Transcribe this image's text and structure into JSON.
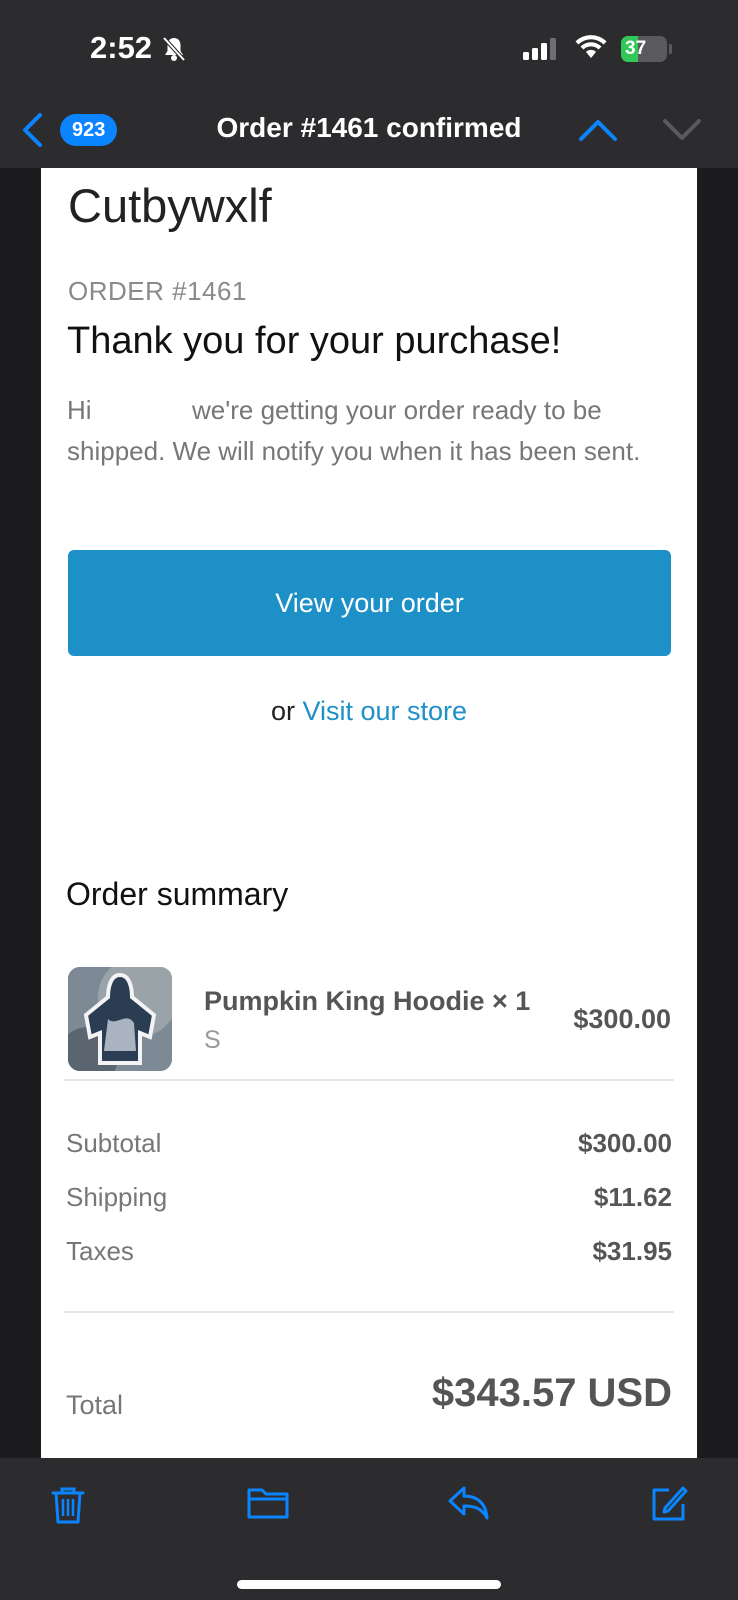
{
  "status_bar": {
    "time": "2:52",
    "battery": "37",
    "battery_level": 0.37
  },
  "nav": {
    "unread_count": "923",
    "title": "Order #1461 confirmed"
  },
  "email": {
    "store_name": "Cutbywxlf",
    "order_number": "ORDER #1461",
    "heading": "Thank you for your purchase!",
    "message_start": "Hi",
    "message_rest": "we're getting your order ready to be shipped. We will notify you when it has been sent.",
    "cta_label": "View your order",
    "alt_prefix": "or",
    "alt_link": "Visit our store",
    "summary_heading": "Order summary",
    "item": {
      "name": "Pumpkin King Hoodie × 1",
      "variant": "S",
      "price": "$300.00"
    },
    "costs": [
      {
        "label": "Subtotal",
        "value": "$300.00"
      },
      {
        "label": "Shipping",
        "value": "$11.62"
      },
      {
        "label": "Taxes",
        "value": "$31.95"
      }
    ],
    "total_label": "Total",
    "total_value": "$343.57 USD"
  },
  "colors": {
    "accent": "#0a84ff",
    "button": "#1e90c8"
  },
  "toolbar": {
    "icons": [
      "trash-icon",
      "folder-icon",
      "reply-icon",
      "compose-icon"
    ]
  }
}
